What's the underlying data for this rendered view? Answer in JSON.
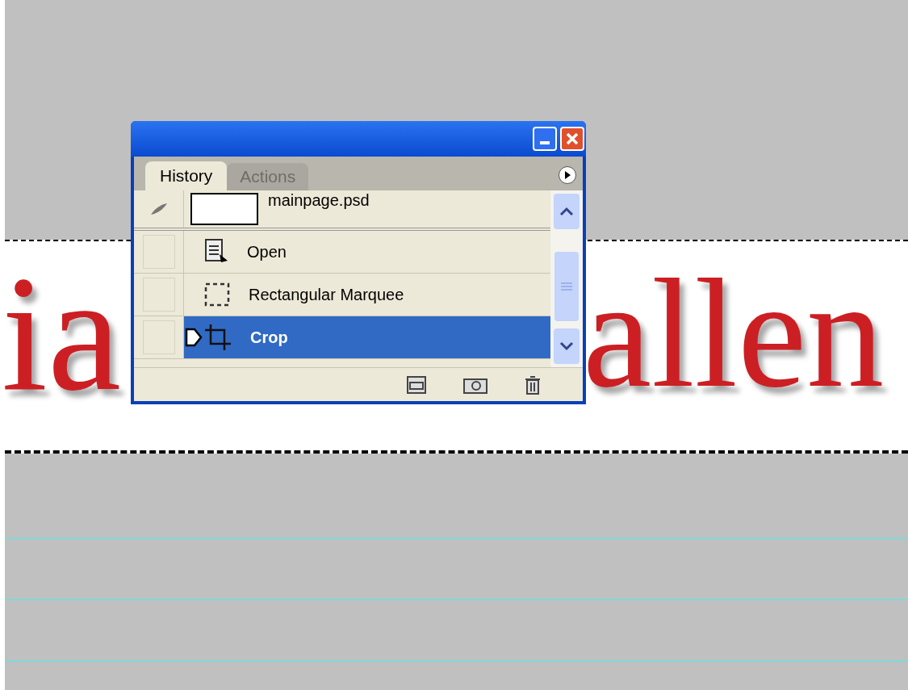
{
  "canvas": {
    "texts": [
      "ia",
      "allen"
    ]
  },
  "panel": {
    "tabs": [
      {
        "label": "History",
        "selected": true
      },
      {
        "label": "Actions",
        "selected": false
      }
    ],
    "snapshot": {
      "label": "mainpage.psd"
    },
    "history_items": [
      {
        "label": "Open",
        "kind": "open",
        "selected": false,
        "snapshot_source": false
      },
      {
        "label": "Rectangular Marquee",
        "kind": "marquee",
        "selected": false,
        "snapshot_source": false
      },
      {
        "label": "Crop",
        "kind": "crop",
        "selected": true,
        "snapshot_source": false
      }
    ]
  }
}
